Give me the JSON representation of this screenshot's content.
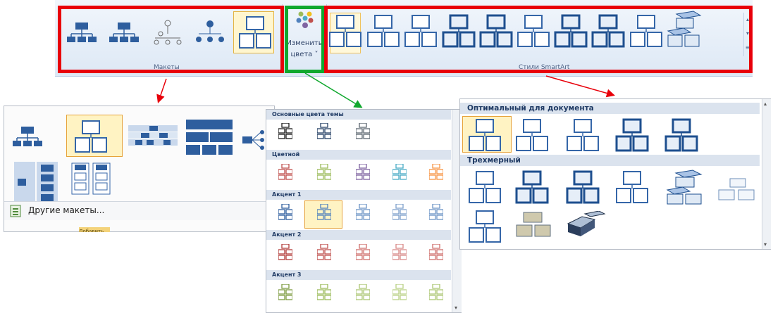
{
  "ribbon": {
    "layouts_group_label": "Макеты",
    "styles_group_label": "Стили SmartArt",
    "change_colors_label_1": "Изменить",
    "change_colors_label_2": "цвета ˅"
  },
  "layouts_panel": {
    "more_layouts_label": "Другие макеты...",
    "cut_off_button_label": "Добавить"
  },
  "colors_panel": {
    "sections": [
      "Основные цвета темы",
      "Цветной",
      "Акцент 1",
      "Акцент 2",
      "Акцент 3"
    ]
  },
  "styles_panel": {
    "sections": [
      "Оптимальный для документа",
      "Трехмерный"
    ]
  },
  "colors": {
    "annotation_red": "#e8000a",
    "annotation_green": "#10a82e",
    "selection": "#e7a33b",
    "accent1": "#4f81bd",
    "accent2": "#c0504d",
    "accent3": "#9bbb59"
  }
}
